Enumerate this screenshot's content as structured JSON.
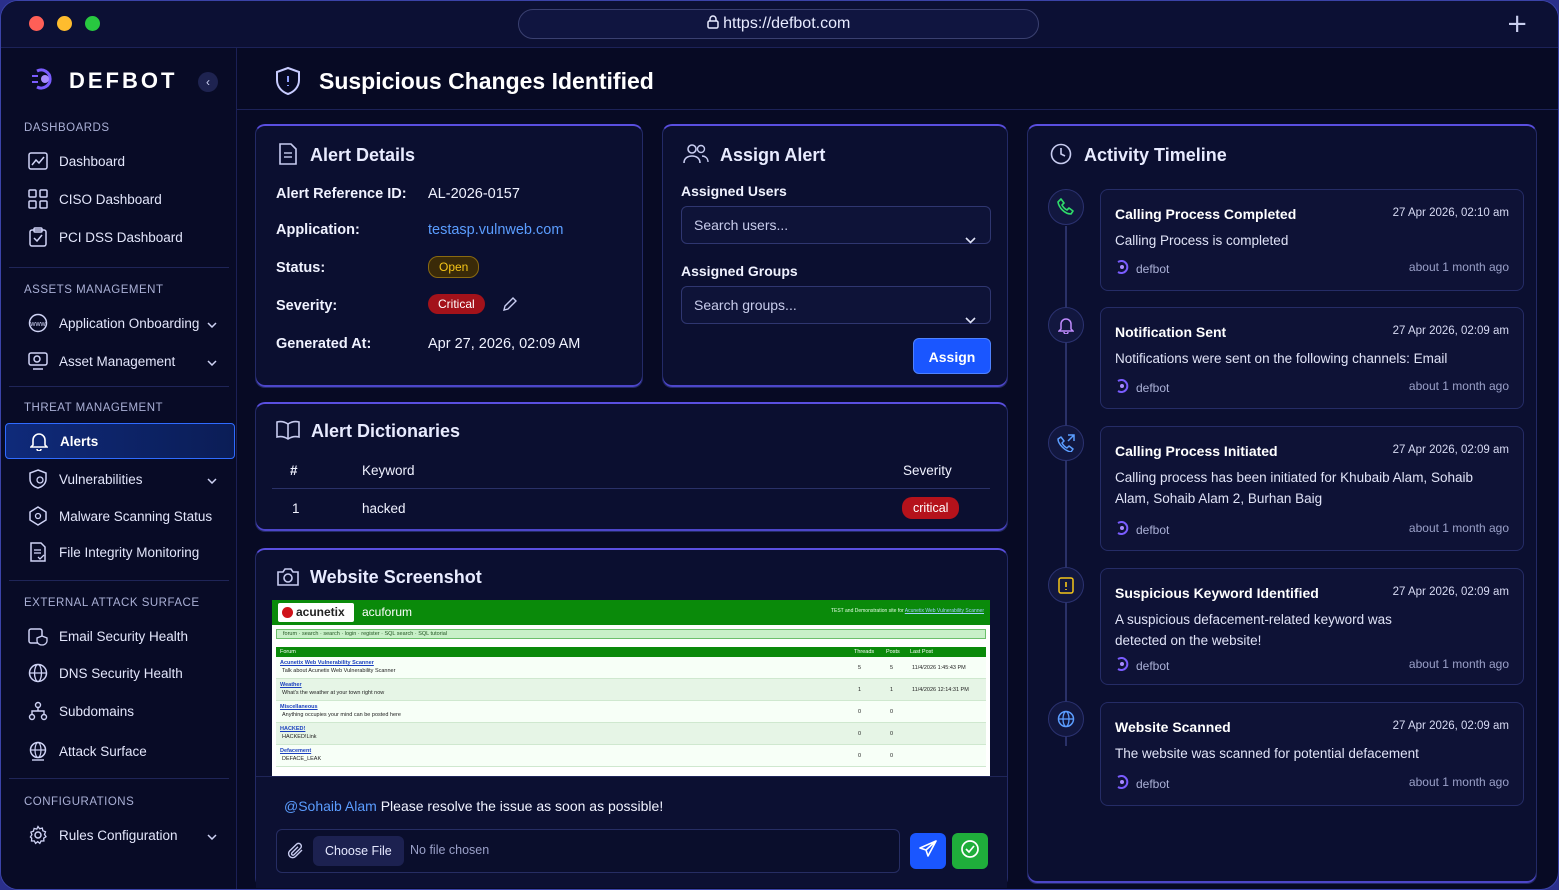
{
  "browser": {
    "url": "https://defbot.com"
  },
  "brand": {
    "name": "DEFBOT"
  },
  "sidebar": {
    "sections": {
      "dashboards": "DASHBOARDS",
      "assets": "ASSETS MANAGEMENT",
      "threat": "THREAT MANAGEMENT",
      "external": "EXTERNAL ATTACK SURFACE",
      "config": "CONFIGURATIONS"
    },
    "items": {
      "dashboard": "Dashboard",
      "ciso": "CISO Dashboard",
      "pci": "PCI DSS Dashboard",
      "app_onboarding": "Application Onboarding",
      "asset_mgmt": "Asset Management",
      "alerts": "Alerts",
      "vulns": "Vulnerabilities",
      "malware": "Malware Scanning Status",
      "fim": "File Integrity Monitoring",
      "email": "Email Security Health",
      "dns": "DNS Security Health",
      "subdomains": "Subdomains",
      "attack": "Attack Surface",
      "rules": "Rules Configuration"
    }
  },
  "page": {
    "title": "Suspicious Changes Identified"
  },
  "alert_details": {
    "title": "Alert Details",
    "ref_label": "Alert Reference ID:",
    "ref_value": "AL-2026-0157",
    "app_label": "Application:",
    "app_value": "testasp.vulnweb.com",
    "status_label": "Status:",
    "status_value": "Open",
    "severity_label": "Severity:",
    "severity_value": "Critical",
    "generated_label": "Generated At:",
    "generated_value": "Apr 27, 2026, 02:09 AM"
  },
  "assign": {
    "title": "Assign Alert",
    "users_label": "Assigned Users",
    "users_placeholder": "Search users...",
    "groups_label": "Assigned Groups",
    "groups_placeholder": "Search groups...",
    "button": "Assign"
  },
  "dictionaries": {
    "title": "Alert Dictionaries",
    "headers": {
      "num": "#",
      "keyword": "Keyword",
      "severity": "Severity"
    },
    "rows": [
      {
        "num": "1",
        "keyword": "hacked",
        "severity": "critical"
      }
    ]
  },
  "screenshot": {
    "title": "Website Screenshot",
    "site": {
      "brand": "acunetix",
      "forum": "acuforum",
      "tagline": "TEST and Demonstration site for",
      "tagline_link": "Acunetix Web Vulnerability Scanner",
      "menu": "forum · search · search · login · register · SQL search · SQL tutorial",
      "headers": [
        "Forum",
        "Threads",
        "Posts",
        "Last Post"
      ],
      "rows": [
        {
          "name": "Acunetix Web Vulnerability Scanner",
          "desc": "Talk about Acunetix Web Vulnerability Scanner",
          "threads": "5",
          "posts": "5",
          "last": "11/4/2026 1:45:43 PM"
        },
        {
          "name": "Weather",
          "desc": "What's the weather at your town right now",
          "threads": "1",
          "posts": "1",
          "last": "11/4/2026 12:14:31 PM"
        },
        {
          "name": "Miscellaneous",
          "desc": "Anything occupies your mind can be posted here",
          "threads": "0",
          "posts": "0",
          "last": ""
        },
        {
          "name": "HACKED!",
          "desc": "HACKED!Link",
          "threads": "0",
          "posts": "0",
          "last": ""
        },
        {
          "name": "Defacement",
          "desc": "DEFACE_LEAK",
          "threads": "0",
          "posts": "0",
          "last": ""
        }
      ]
    }
  },
  "comment": {
    "mention": "@Sohaib Alam",
    "text": " Please resolve the issue as soon as possible!",
    "choose_file": "Choose File",
    "no_file": "No file chosen"
  },
  "timeline": {
    "title": "Activity Timeline",
    "items": [
      {
        "title": "Calling Process Completed",
        "date": "27 Apr 2026, 02:10 am",
        "msg": "Calling Process is completed",
        "user": "defbot",
        "ago": "about 1 month ago"
      },
      {
        "title": "Notification Sent",
        "date": "27 Apr 2026, 02:09 am",
        "msg": "Notifications were sent on the following channels: Email",
        "user": "defbot",
        "ago": "about 1 month ago"
      },
      {
        "title": "Calling Process Initiated",
        "date": "27 Apr 2026, 02:09 am",
        "msg": "Calling process has been initiated for Khubaib Alam, Sohaib Alam, Sohaib Alam 2, Burhan Baig",
        "user": "defbot",
        "ago": "about 1 month ago"
      },
      {
        "title": "Suspicious Keyword Identified",
        "date": "27 Apr 2026, 02:09 am",
        "msg": "A suspicious defacement-related keyword was detected on the website!",
        "user": "defbot",
        "ago": "about 1 month ago"
      },
      {
        "title": "Website Scanned",
        "date": "27 Apr 2026, 02:09 am",
        "msg": "The website was scanned for potential defacement",
        "user": "defbot",
        "ago": "about 1 month ago"
      }
    ]
  },
  "colors": {
    "accent": "#2f6bff",
    "critical": "#c01818",
    "open": "#f5c518",
    "success": "#1fae3b"
  }
}
